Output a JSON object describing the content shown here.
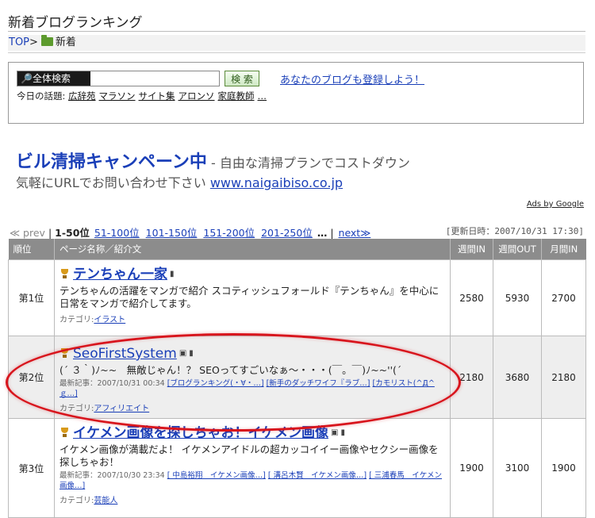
{
  "page": {
    "title": "新着ブログランキング"
  },
  "breadcrumb": {
    "top": "TOP",
    "sep": ">",
    "current": "新着"
  },
  "search": {
    "label": "全体検索",
    "value": "",
    "button": "検 索",
    "register_link": "あなたのブログも登録しよう！",
    "topics_label": "今日の話題:",
    "topics": [
      "広辞苑",
      "マラソン",
      "サイト集",
      "アロンソ",
      "家庭教師",
      "…"
    ]
  },
  "ad": {
    "title": "ビル清掃キャンペーン中",
    "subtitle": " - 自由な清掃プランでコストダウン",
    "line_text": "気軽にURLでお問い合わせ下さい ",
    "url": "www.naigaibiso.co.jp",
    "ads_by": "Ads by Google"
  },
  "pager": {
    "prev": "≪ prev",
    "sep": "|",
    "current": "1-50位",
    "pages": [
      "51-100位",
      "101-150位",
      "151-200位",
      "201-250位"
    ],
    "dots": "…",
    "next": "next≫"
  },
  "updated": "[更新日時：2007/10/31 17:30]",
  "table": {
    "headers": {
      "rank": "順位",
      "name": "ページ名称／紹介文",
      "week_in": "週間IN",
      "week_out": "週間OUT",
      "month_in": "月間IN"
    },
    "cat_label": "カテゴリ:",
    "latest_label": "最新記事：",
    "rows": [
      {
        "rank": "第1位",
        "title": "テンちゃん一家",
        "desc": "テンちゃんの活躍をマンガで紹介 スコティッシュフォールド『テンちゃん』を中心に日常をマンガで紹介してます。",
        "category": "イラスト",
        "week_in": "2580",
        "week_out": "5930",
        "month_in": "2700"
      },
      {
        "rank": "第2位",
        "title": "SeoFirstSystem",
        "desc": "(´ ３｀)ﾉ~~　無敵じゃん！？ SEOってすごいなぁ～・・・(￣。￣)ﾉ~~''(´",
        "latest_date": "2007/10/31 00:34",
        "latest": [
          "[ブログランキング(・∀・…]",
          "[新手のダッチワイフ『ラブ…]",
          "[カモリスト(^Д^ｇ…]"
        ],
        "category": "アフィリエイト",
        "week_in": "2180",
        "week_out": "3680",
        "month_in": "2180"
      },
      {
        "rank": "第3位",
        "title": "イケメン画像を探しちゃお！イケメン画像",
        "desc": "イケメン画像が満載だよ！ イケメンアイドルの超カッコイイー画像やセクシー画像を探しちゃお！",
        "latest_date": "2007/10/30 23:34",
        "latest": [
          "[ 中島裕翔　イケメン画像…]",
          "[ 溝呂木賢　イケメン画像…]",
          "[ 三浦春馬　イケメン画像…]"
        ],
        "category": "芸能人",
        "week_in": "1900",
        "week_out": "3100",
        "month_in": "1900"
      }
    ]
  },
  "colors": {
    "link": "#1a3fb8",
    "header_bg": "#8c8c8c",
    "highlight": "#d8141c"
  }
}
